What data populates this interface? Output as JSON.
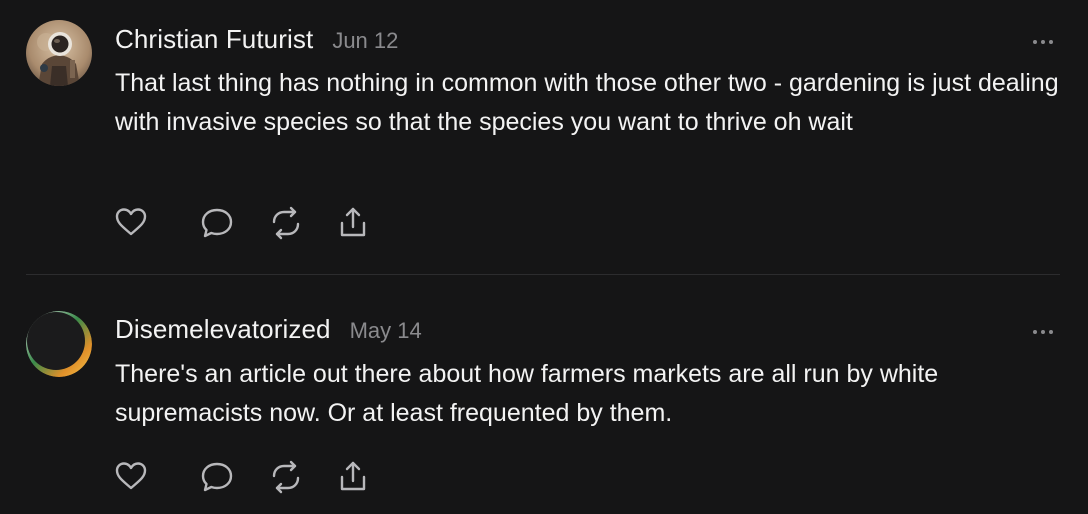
{
  "posts": [
    {
      "author": "Christian Futurist",
      "date": "Jun 12",
      "text": "That last thing has nothing in common with those other two - gardening is just dealing with invasive species so that the species you want to thrive oh wait",
      "avatar_icon": "astronaut-avatar"
    },
    {
      "author": "Disemelevatorized",
      "date": "May 14",
      "text": "There's an article out there about how farmers markets are all run by white supremacists now. Or at least frequented by them.",
      "avatar_icon": "eclipse-avatar"
    }
  ],
  "icons": {
    "more": "more-horizontal-icon",
    "like": "heart-icon",
    "reply": "comment-icon",
    "repost": "repost-icon",
    "share": "share-icon"
  },
  "colors": {
    "background": "#151516",
    "text": "#f3f3f3",
    "muted": "#8a8a8d",
    "divider": "#2c2c2e"
  }
}
